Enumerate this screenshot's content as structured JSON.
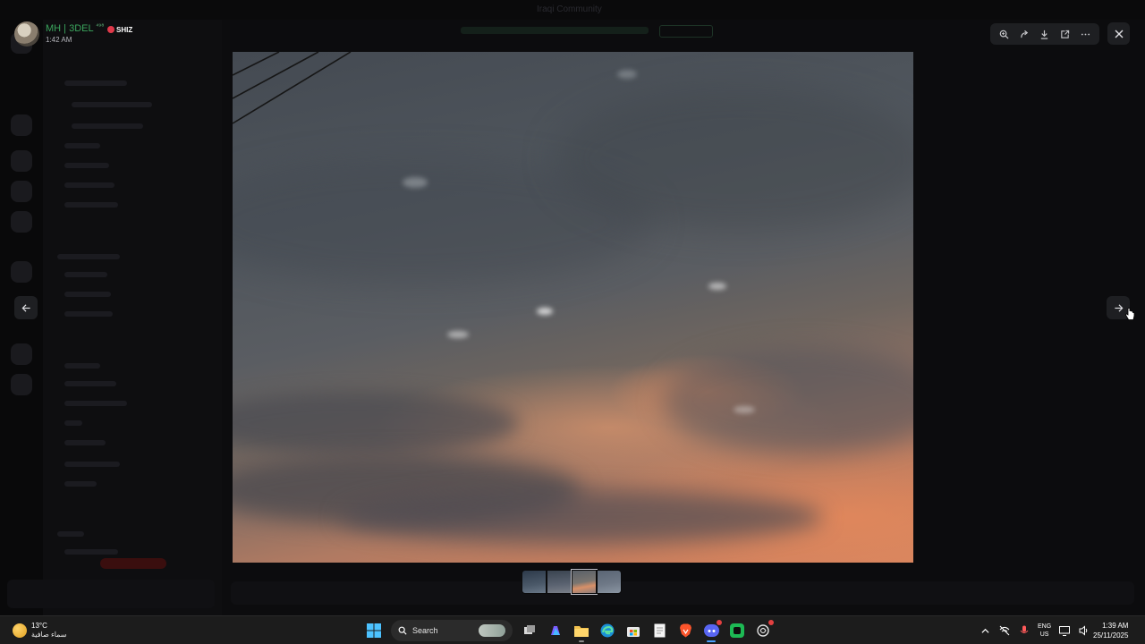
{
  "window": {
    "title": "Iraqi Community"
  },
  "viewer": {
    "username": "MH | 3DEL",
    "username_superscript": "⁴⁹⁸",
    "tag": "SHIZ",
    "timestamp": "1:42 AM",
    "toolbar": [
      {
        "name": "zoom-icon",
        "label": "Zoom"
      },
      {
        "name": "forward-icon",
        "label": "Forward"
      },
      {
        "name": "download-icon",
        "label": "Download"
      },
      {
        "name": "open-in-browser-icon",
        "label": "Open in Browser"
      },
      {
        "name": "more-icon",
        "label": "More"
      }
    ],
    "close": "close-icon",
    "prev": "arrow-left-icon",
    "next": "arrow-right-icon",
    "thumbnails_count": 4,
    "selected_thumbnail": 3
  },
  "taskbar": {
    "weather": {
      "temp": "13°C",
      "condition": "سماء صافية"
    },
    "search_label": "Search",
    "apps": [
      "windows-start-icon",
      "search",
      "task-view-icon",
      "copilot-icon",
      "file-explorer-icon",
      "edge-icon",
      "store-icon",
      "notepad-icon",
      "brave-icon",
      "discord-icon",
      "app-green-icon",
      "chatgpt-icon"
    ],
    "language": {
      "line1": "ENG",
      "line2": "US"
    },
    "clock": {
      "time": "1:39 AM",
      "date": "25/11/2025"
    }
  },
  "colors": {
    "accent_green": "#3ba55d",
    "taskbar": "#1c1c1c",
    "tag_red": "#e0394a"
  }
}
